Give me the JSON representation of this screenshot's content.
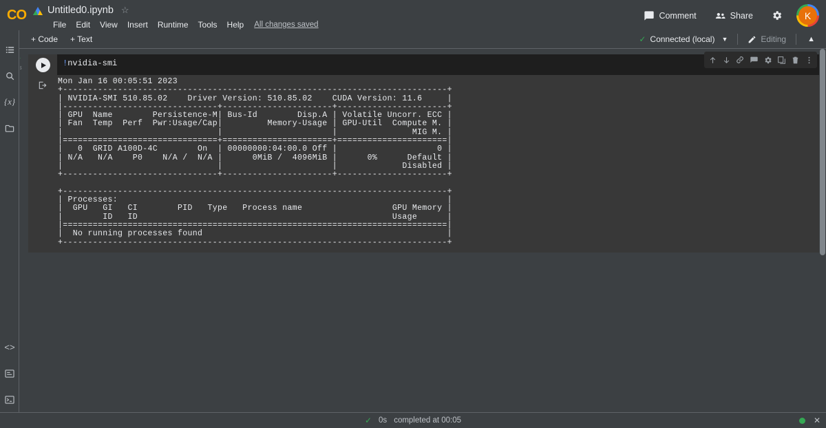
{
  "header": {
    "logo_text": "CO",
    "drive_icon": "drive-icon",
    "notebook_title": "Untitled0.ipynb",
    "star_icon": "star-outline-icon",
    "menu": [
      "File",
      "Edit",
      "View",
      "Insert",
      "Runtime",
      "Tools",
      "Help"
    ],
    "save_status": "All changes saved",
    "comment_label": "Comment",
    "comment_icon": "comment-icon",
    "share_label": "Share",
    "share_icon": "people-icon",
    "settings_icon": "gear-icon",
    "avatar_initial": "K"
  },
  "toolbar": {
    "add_code_label": "+ Code",
    "add_text_label": "+ Text",
    "connect_status": "Connected (local)",
    "connect_check_icon": "check-icon",
    "connect_caret_icon": "chevron-down-icon",
    "editing_label": "Editing",
    "editing_icon": "pencil-icon",
    "collapse_icon": "chevron-up-icon"
  },
  "rail": {
    "top_items": [
      {
        "name": "toc-icon",
        "label": "Table of contents"
      },
      {
        "name": "search-icon",
        "label": "Find and replace"
      },
      {
        "name": "variables-icon",
        "label": "{x}"
      },
      {
        "name": "files-icon",
        "label": "Files"
      }
    ],
    "bottom_items": [
      {
        "name": "code-snippets-icon",
        "label": "<>"
      },
      {
        "name": "command-palette-icon",
        "label": "Command palette"
      },
      {
        "name": "terminal-icon",
        "label": "Terminal"
      }
    ]
  },
  "cell": {
    "execution_check": "✓",
    "execution_time": "0s",
    "run_button_icon": "play-icon",
    "code": "!nvidia-smi",
    "code_bang": "!",
    "code_rest": "nvidia-smi",
    "toolbar_icons": [
      "move-cell-up-icon",
      "move-cell-down-icon",
      "link-to-cell-icon",
      "add-comment-icon",
      "cell-settings-icon",
      "copy-cell-icon",
      "delete-cell-icon",
      "more-vert-icon"
    ],
    "output_icon": "open-output-icon",
    "output": "Mon Jan 16 00:05:51 2023\n+-----------------------------------------------------------------------------+\n| NVIDIA-SMI 510.85.02    Driver Version: 510.85.02    CUDA Version: 11.6     |\n|-------------------------------+----------------------+----------------------+\n| GPU  Name        Persistence-M| Bus-Id        Disp.A | Volatile Uncorr. ECC |\n| Fan  Temp  Perf  Pwr:Usage/Cap|         Memory-Usage | GPU-Util  Compute M. |\n|                               |                      |               MIG M. |\n|===============================+======================+======================|\n|   0  GRID A100D-4C        On  | 00000000:04:00.0 Off |                    0 |\n| N/A   N/A    P0    N/A /  N/A |      0MiB /  4096MiB |      0%      Default |\n|                               |                      |             Disabled |\n+-------------------------------+----------------------+----------------------+\n                                                                               \n+-----------------------------------------------------------------------------+\n| Processes:                                                                  |\n|  GPU   GI   CI        PID   Type   Process name                  GPU Memory |\n|        ID   ID                                                   Usage      |\n|=============================================================================|\n|  No running processes found                                                 |\n+-----------------------------------------------------------------------------+"
  },
  "status_bar": {
    "check_icon": "check-icon",
    "duration": "0s",
    "message": "completed at 00:05",
    "connection_dot": "green-status-dot",
    "close_icon": "close-icon"
  },
  "colors": {
    "accent_orange": "#f9ab00",
    "avatar_bg": "#e8710a",
    "success_green": "#34a853",
    "page_bg": "#3c4043",
    "cell_bg": "#383838",
    "editor_bg": "#1e1e1e",
    "text_primary": "#e8eaed",
    "text_secondary": "#bdc1c6"
  }
}
